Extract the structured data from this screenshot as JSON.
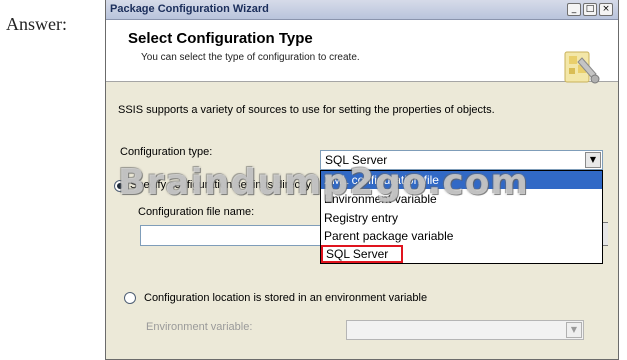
{
  "answer_label": "Answer:",
  "window": {
    "title": "Package Configuration Wizard",
    "controls": {
      "minimize": "_",
      "maximize": "□",
      "close": "×"
    }
  },
  "header": {
    "title": "Select Configuration Type",
    "subtitle": "You can select the type of configuration to create."
  },
  "intro_text": "SSIS supports a variety of sources to use for setting the properties of objects.",
  "configuration_type": {
    "label": "Configuration type:",
    "value": "SQL Server",
    "options": [
      {
        "label": "XML configuration file",
        "highlighted": true
      },
      {
        "label": "Environment variable",
        "highlighted": false
      },
      {
        "label": "Registry entry",
        "highlighted": false
      },
      {
        "label": "Parent package variable",
        "highlighted": false
      },
      {
        "label": "SQL Server",
        "highlighted": false,
        "outlined": true
      }
    ]
  },
  "option_specify_directly": {
    "label": "Specify configuration settings directly",
    "selected": true,
    "file_name_label": "Configuration file name:",
    "file_name_value": ""
  },
  "option_environment": {
    "label": "Configuration location is stored in an environment variable",
    "selected": false,
    "variable_label": "Environment variable:",
    "variable_value": ""
  },
  "watermark": "Braindump2go.com",
  "icon": "wizard-puzzle-icon"
}
